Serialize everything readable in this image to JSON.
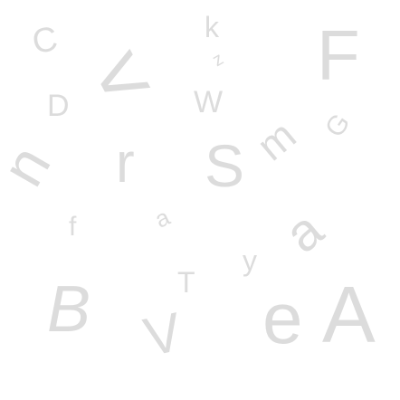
{
  "captcha": {
    "glyph_color": "#dcdcdc",
    "background": "#ffffff",
    "characters": [
      "C",
      "k",
      "F",
      "<",
      "D",
      "W",
      "z",
      "G",
      "m",
      "n",
      "r",
      "S",
      "f",
      "a",
      "a",
      "y",
      "T",
      "B",
      "V",
      "e",
      "A"
    ]
  }
}
